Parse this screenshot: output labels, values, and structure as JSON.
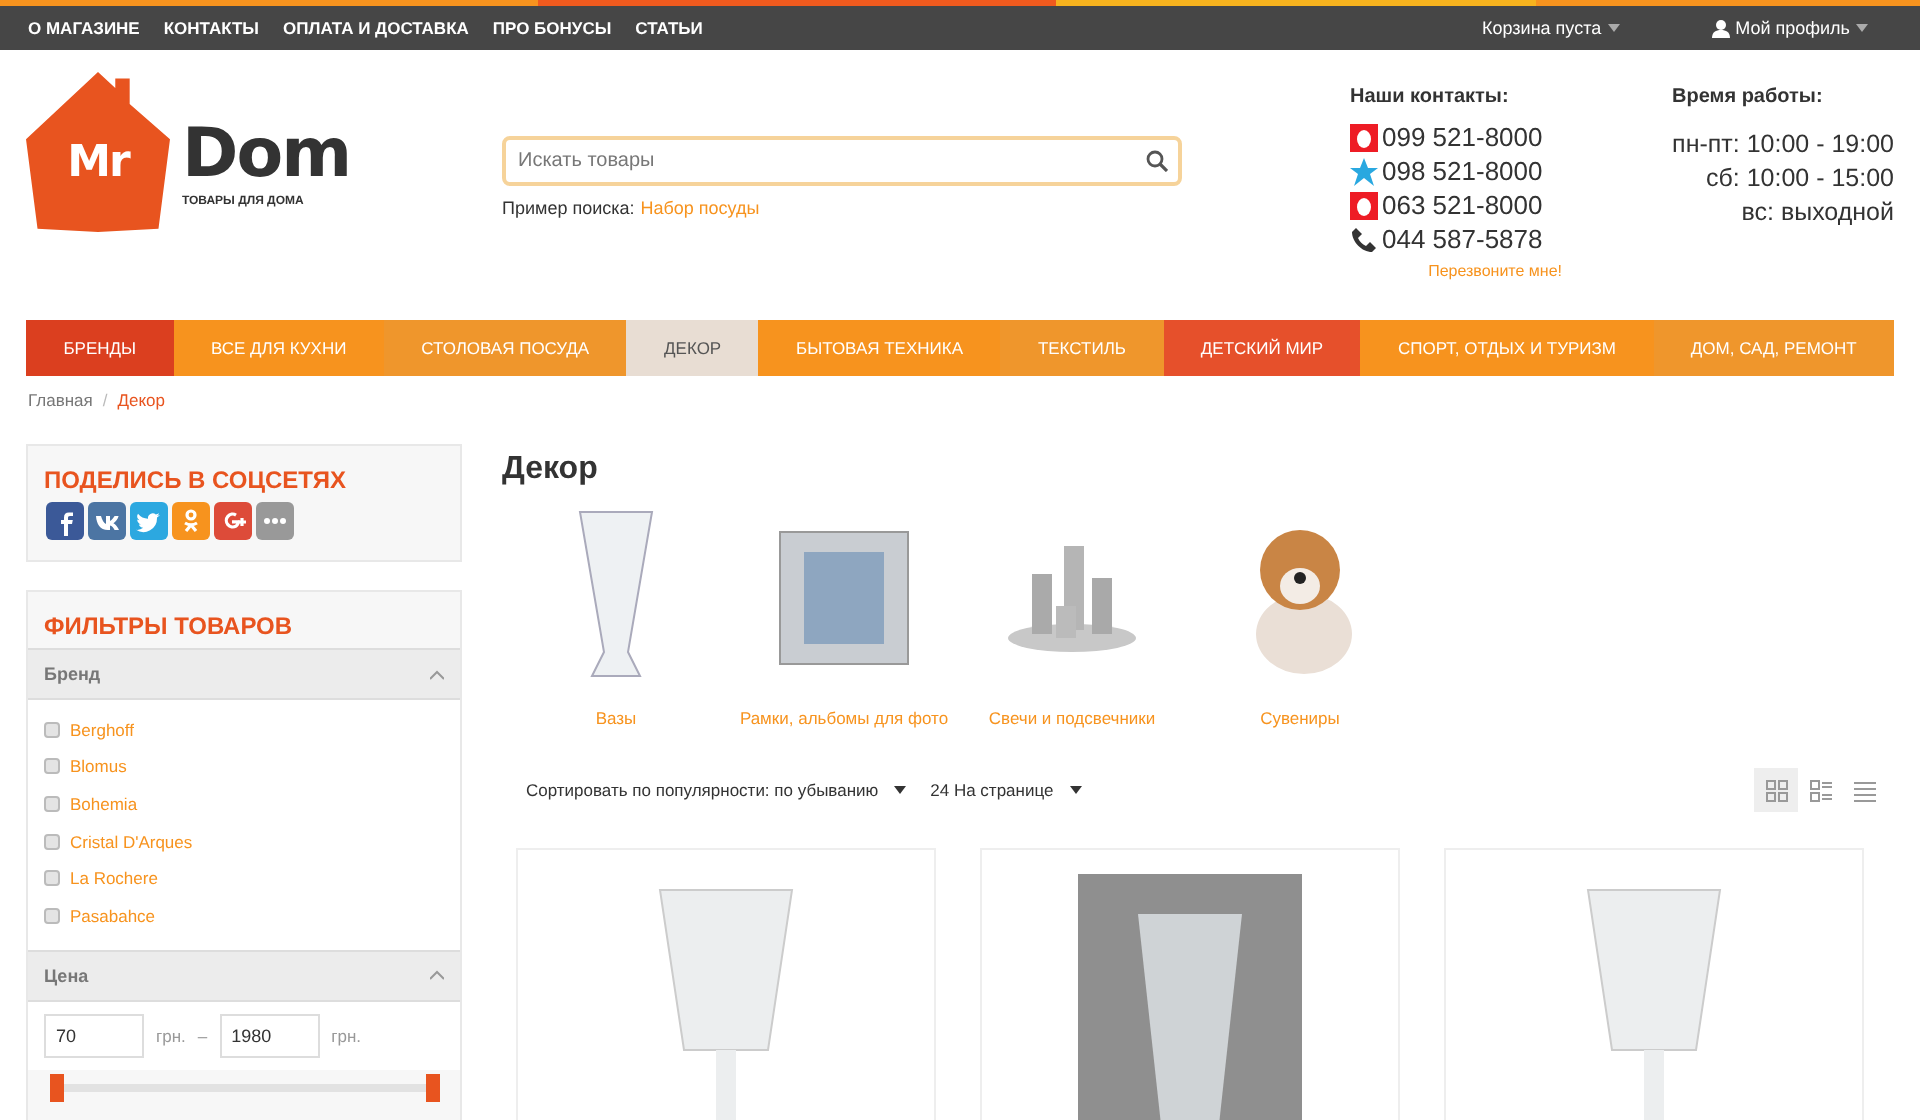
{
  "top_menu": {
    "links": [
      "О МАГАЗИНЕ",
      "КОНТАКТЫ",
      "ОПЛАТА И ДОСТАВКА",
      "ПРО БОНУСЫ",
      "СТАТЬИ"
    ],
    "cart": "Корзина пуста",
    "profile": "Мой профиль"
  },
  "logo": {
    "mark": "Mr",
    "name": "Dom",
    "tagline": "ТОВАРЫ ДЛЯ ДОМА"
  },
  "search": {
    "placeholder": "Искать товары",
    "example_label": "Пример поиска:",
    "example_link": "Набор посуды"
  },
  "contacts": {
    "title": "Наши контакты:",
    "phones": [
      {
        "kind": "square",
        "color": "#ee1c25",
        "number": "099 521-8000"
      },
      {
        "kind": "star",
        "color": "#29a8e0",
        "number": "098 521-8000"
      },
      {
        "kind": "square",
        "color": "#ee1c25",
        "number": "063 521-8000"
      },
      {
        "kind": "phone",
        "color": "#333333",
        "number": "044 587-5878"
      }
    ],
    "callback": "Перезвоните мне!"
  },
  "hours": {
    "title": "Время работы:",
    "lines": [
      "пн-пт: 10:00 - 19:00",
      "сб: 10:00 - 15:00",
      "вс: выходной"
    ]
  },
  "nav": [
    {
      "label": "БРЕНДЫ",
      "color": "#db3f1f",
      "selected": false
    },
    {
      "label": "ВСЕ ДЛЯ КУХНИ",
      "color": "#f7931e",
      "selected": false
    },
    {
      "label": "СТОЛОВАЯ ПОСУДА",
      "color": "#ef962c",
      "selected": false
    },
    {
      "label": "ДЕКОР",
      "color": "#e8ddd3",
      "selected": true
    },
    {
      "label": "БЫТОВАЯ ТЕХНИКА",
      "color": "#f7931e",
      "selected": false
    },
    {
      "label": "ТЕКСТИЛЬ",
      "color": "#ef962c",
      "selected": false
    },
    {
      "label": "ДЕТСКИЙ МИР",
      "color": "#e6502b",
      "selected": false
    },
    {
      "label": "СПОРТ, ОТДЫХ И ТУРИЗМ",
      "color": "#f7931e",
      "selected": false
    },
    {
      "label": "ДОМ, САД, РЕМОНТ",
      "color": "#ef962c",
      "selected": false
    }
  ],
  "breadcrumb": {
    "items": [
      "Главная",
      "Декор"
    ],
    "separator": "/"
  },
  "share": {
    "title": "ПОДЕЛИСЬ В СОЦСЕТЯХ",
    "networks": [
      {
        "kind": "f",
        "color": "#3b5998"
      },
      {
        "kind": "vk",
        "color": "#4c75a3"
      },
      {
        "kind": "bird",
        "color": "#2ca8e0"
      },
      {
        "kind": "ok",
        "color": "#f7931e"
      },
      {
        "kind": "g",
        "color": "#dd4b39"
      },
      {
        "kind": "more",
        "color": "#999999"
      }
    ]
  },
  "filters": {
    "title": "ФИЛЬТРЫ ТОВАРОВ",
    "brand": {
      "title": "Бренд",
      "expanded": true,
      "items": [
        {
          "label": "Berghoff",
          "checked": false
        },
        {
          "label": "Blomus",
          "checked": false
        },
        {
          "label": "Bohemia",
          "checked": false
        },
        {
          "label": "Cristal D'Arques",
          "checked": false
        },
        {
          "label": "La Rochere",
          "checked": false
        },
        {
          "label": "Pasabahce",
          "checked": false
        }
      ]
    },
    "price": {
      "title": "Цена",
      "expanded": true,
      "from": "70",
      "to": "1980",
      "currency_1": "грн.",
      "separator": "–",
      "currency_2": "грн.",
      "thumbs": [
        {
          "level": 0
        },
        {
          "level": 1
        }
      ]
    }
  },
  "page_title": "Декор",
  "categories": [
    {
      "label": "Вазы"
    },
    {
      "label": "Рамки, альбомы для фото"
    },
    {
      "label": "Свечи и подсвечники"
    },
    {
      "label": "Сувениры"
    }
  ],
  "toolbar": {
    "sort": "Сортировать по популярности: по убыванию",
    "per_page": "24 На странице",
    "views": [
      {
        "kind": "grid",
        "selected": true
      },
      {
        "kind": "list-grid",
        "selected": false
      },
      {
        "kind": "list",
        "selected": false
      }
    ]
  },
  "products": [
    {
      "kind": "light"
    },
    {
      "kind": "dark"
    },
    {
      "kind": "light"
    }
  ]
}
